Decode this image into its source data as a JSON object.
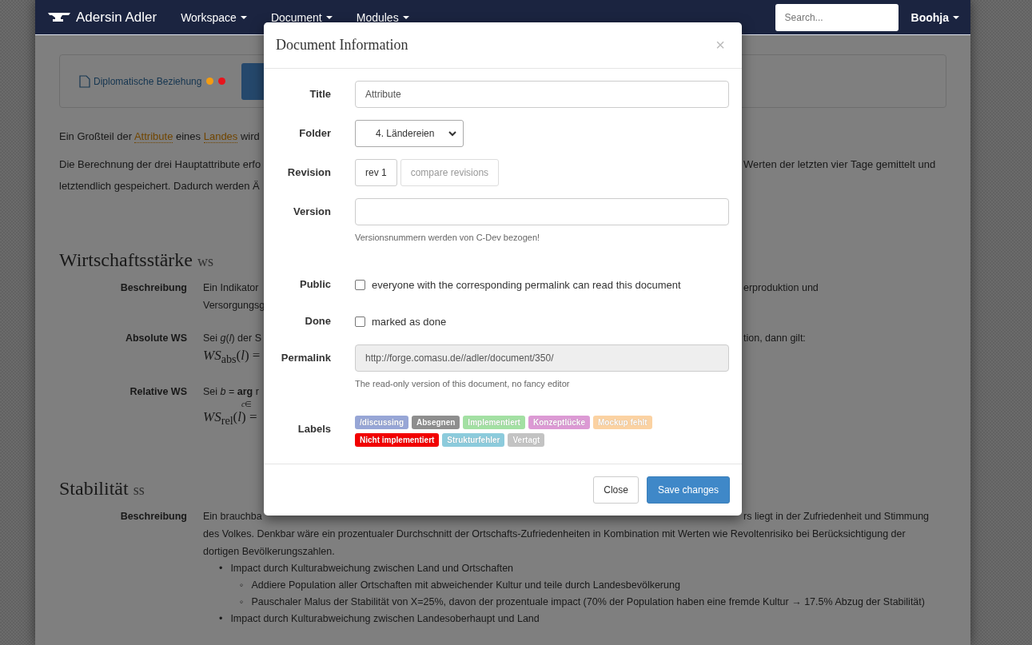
{
  "navbar": {
    "brand": "Adersin Adler",
    "menus": [
      "Workspace",
      "Document",
      "Modules"
    ],
    "search": {
      "placeholder": "Search..."
    },
    "user": "Boohja"
  },
  "page": {
    "panel": {
      "link": "Diplomatische Beziehung",
      "dots": [
        {
          "color": "#f39c12"
        },
        {
          "color": "#e8141c"
        }
      ]
    },
    "intro": [
      {
        "kind": "split",
        "left": [
          {
            "kind": "text",
            "text": "Ein Großteil der"
          },
          {
            "kind": "link",
            "text": "Attribute"
          },
          {
            "kind": "text",
            "text": "eines"
          },
          {
            "kind": "link",
            "text": "Landes"
          },
          {
            "kind": "text",
            "text": "wird"
          }
        ]
      },
      {
        "kind": "split",
        "left": [
          {
            "kind": "text",
            "text": "Die Berechnung der drei Hauptattribute erfo"
          }
        ],
        "right": "Werten der letzten vier Tage gemittelt und"
      },
      {
        "kind": "split",
        "left": [
          {
            "kind": "text",
            "text": "letztendlich gespeichert. Dadurch werden Ä"
          }
        ]
      }
    ],
    "sections": [
      {
        "title": "Wirtschaftsstärke",
        "abbr": "ws",
        "rows": [
          {
            "label": "Beschreibung",
            "lines": [
              {
                "kind": "split",
                "left": "Ein Indikator",
                "right": "erproduktion und"
              },
              {
                "kind": "split",
                "left": "Versorgungsg"
              }
            ]
          },
          {
            "label": "Absolute WS",
            "lines": [
              {
                "kind": "split",
                "left": "Sei *g*(*l*) der S",
                "right": "tion, dann gilt:"
              },
              {
                "kind": "formula",
                "left": "*WS*$_{abs}$(*l*) ="
              }
            ]
          },
          {
            "label": "Relative WS",
            "lines": [
              {
                "kind": "split",
                "left": "Sei *b* = **arg** r"
              },
              {
                "kind": "subscript",
                "left": "*c*∈"
              },
              {
                "kind": "formula",
                "left": "*WS*$_{rel}$(*l*) ="
              }
            ]
          }
        ]
      },
      {
        "title": "Stabilität",
        "abbr": "ss",
        "rows": [
          {
            "label": "Beschreibung",
            "lines": [
              {
                "kind": "split",
                "left": "Ein brauchba",
                "right": "rs liegt in der Zufriedenheit und Stimmung"
              },
              {
                "kind": "full",
                "left": "des Volkes. Denkbar wäre ein prozentualer Durchschnitt der Ortschafts-Zufriedenheiten in Kombination mit Werten wie Revoltenrisiko bei Berücksichtigung der"
              },
              {
                "kind": "full",
                "left": "dortigen Bevölkerungszahlen."
              }
            ],
            "bullets": [
              {
                "marker": "•",
                "text": "Impact durch Kulturabweichung zwischen Land und Ortschaften",
                "children": [
                  {
                    "marker": "◦",
                    "text": "Addiere Population aller Ortschaften mit abweichender Kultur und teile durch Landesbevölkerung"
                  },
                  {
                    "marker": "◦",
                    "text": "Pauschaler Malus der Stabilität von X=25%, davon der prozentuale impact (70% der Population haben eine fremde Kultur → 17.5% Abzug der Stabilität)"
                  }
                ]
              },
              {
                "marker": "•",
                "text": "Impact durch Kulturabweichung zwischen Landesoberhaupt und Land"
              }
            ]
          }
        ]
      }
    ]
  },
  "modal": {
    "title": "Document Information",
    "close": "×",
    "fields": [
      {
        "kind": "input",
        "label": "Title",
        "value": "Attribute"
      },
      {
        "kind": "select",
        "label": "Folder",
        "value": "4. Ländereien"
      },
      {
        "kind": "revision",
        "label": "Revision",
        "buttons": [
          "rev 1",
          "compare revisions"
        ]
      },
      {
        "kind": "input",
        "label": "Version",
        "help": "Versionsnummern werden von C-Dev bezogen!"
      },
      {
        "kind": "checkbox",
        "label": "Public",
        "text": "everyone with the corresponding permalink can read this document",
        "checked": false
      },
      {
        "kind": "checkbox",
        "label": "Done",
        "text": "marked as done",
        "checked": false
      },
      {
        "kind": "readonly",
        "label": "Permalink",
        "value": "http://forge.comasu.de//adler/document/350/",
        "help": "The read-only version of this document, no fancy editor"
      },
      {
        "kind": "labels",
        "label": "Labels",
        "labels": [
          {
            "text": "/discussing",
            "color": "#97a6d6"
          },
          {
            "text": "Absegnen",
            "color": "#8e8e8e"
          },
          {
            "text": "Implementiert",
            "color": "#a3e0a3"
          },
          {
            "text": "Konzeptlücke",
            "color": "#dc9ad4"
          },
          {
            "text": "Mockup fehlt",
            "color": "#fbd2a2"
          },
          {
            "text": "Nicht implementiert",
            "color": "#f20000"
          },
          {
            "text": "Strukturfehler",
            "color": "#8ccbdc"
          },
          {
            "text": "Vertagt",
            "color": "#c3c3c3"
          }
        ]
      }
    ],
    "buttons": [
      {
        "text": "Close",
        "kind": "default"
      },
      {
        "text": "Save changes",
        "kind": "primary"
      }
    ]
  }
}
